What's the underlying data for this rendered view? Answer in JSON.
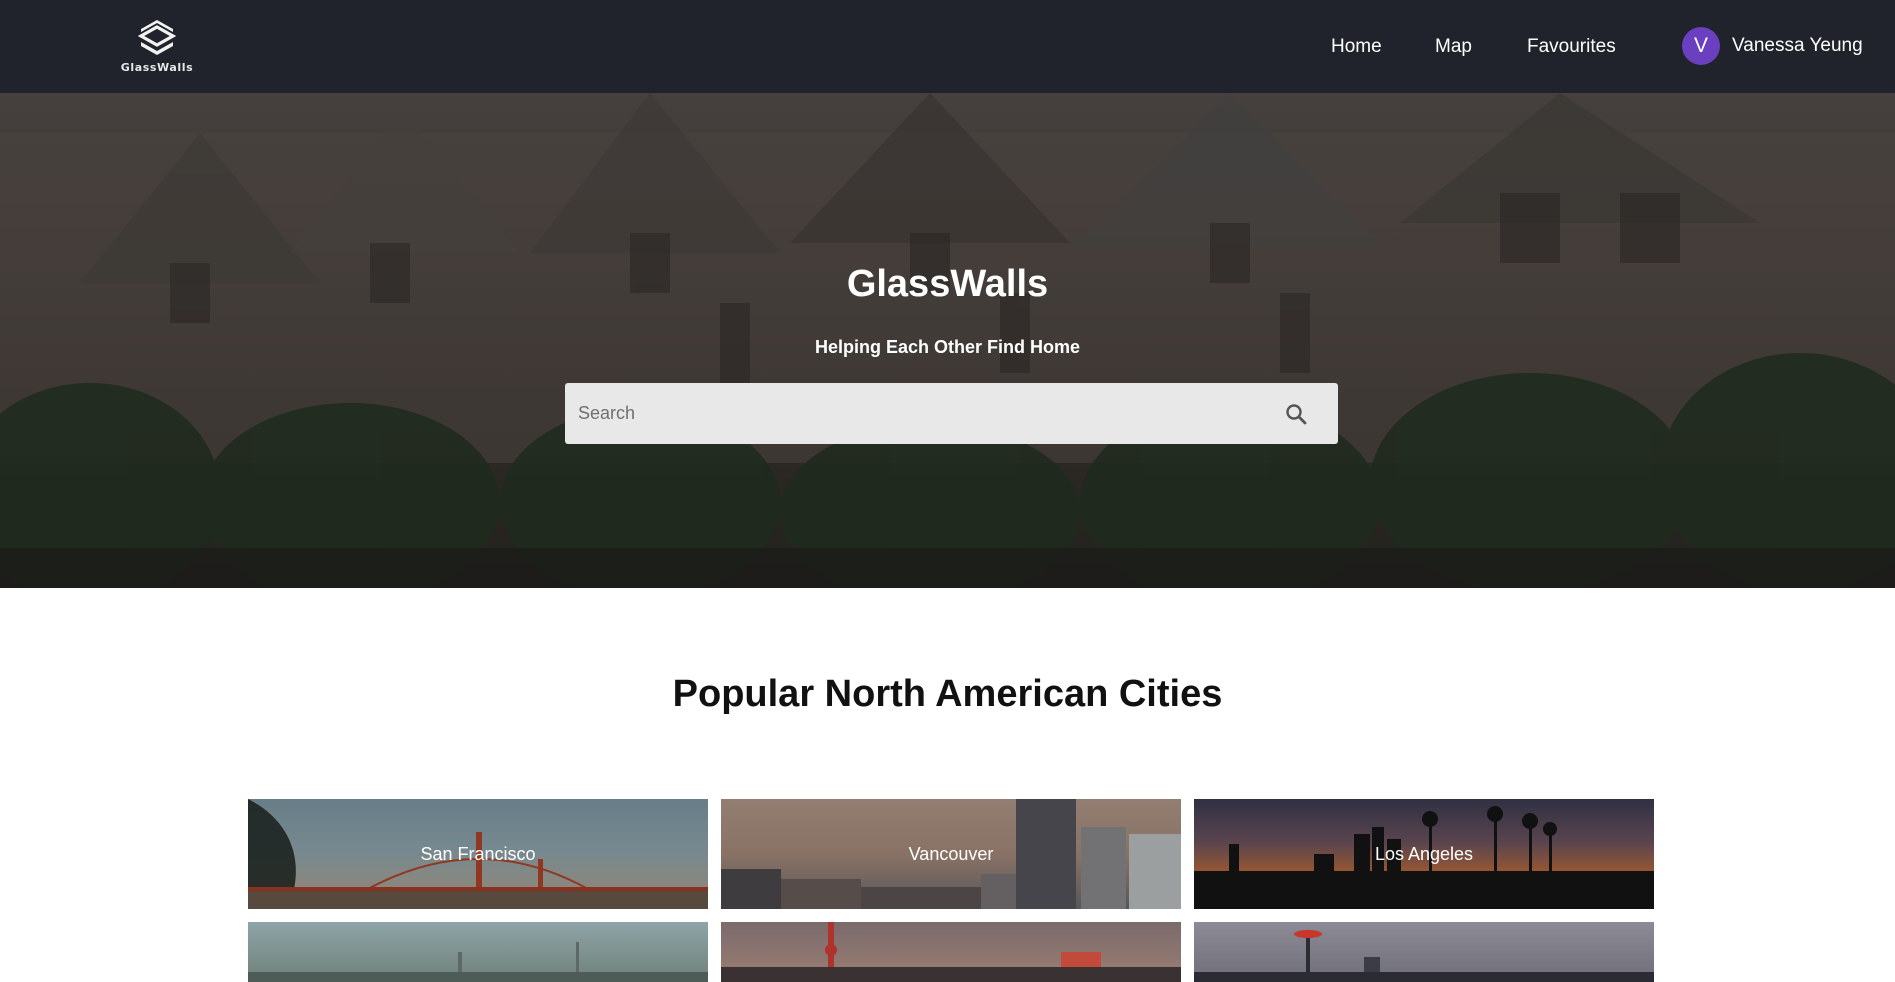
{
  "header": {
    "logo_text": "GlassWalls",
    "nav": [
      {
        "label": "Home"
      },
      {
        "label": "Map"
      },
      {
        "label": "Favourites"
      }
    ],
    "user": {
      "initial": "V",
      "name": "Vanessa Yeung",
      "avatar_color": "#6a3fc0"
    }
  },
  "hero": {
    "title": "GlassWalls",
    "subtitle": "Helping Each Other Find Home",
    "search_placeholder": "Search"
  },
  "section": {
    "title": "Popular North American Cities"
  },
  "cities": [
    {
      "name": "San Francisco"
    },
    {
      "name": "Vancouver"
    },
    {
      "name": "Los Angeles"
    }
  ],
  "colors": {
    "header_bg": "#20232b",
    "search_bg": "#e8e8e8"
  }
}
